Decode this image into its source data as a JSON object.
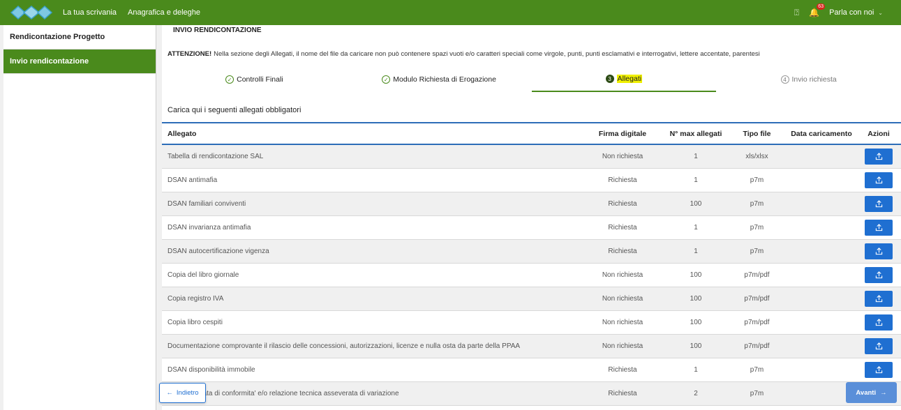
{
  "header": {
    "nav": [
      "La tua scrivania",
      "Anagrafica e deleghe"
    ],
    "notification_count": "63",
    "talk_label": "Parla con noi",
    "colors": {
      "brand": "#4a8a1c",
      "accent": "#1f6fd1"
    }
  },
  "sidebar": {
    "items": [
      {
        "label": "Rendicontazione Progetto"
      },
      {
        "label": "Invio rendicontazione"
      }
    ]
  },
  "main": {
    "title": "INVIO RENDICONTAZIONE",
    "warning_prefix": "ATTENZIONE!",
    "warning_text": "Nella sezione degli Allegati, il nome del file da caricare non può contenere spazi vuoti e/o caratteri speciali come virgole, punti, punti esclamativi e interrogativi, lettere accentate, parentesi",
    "steps": [
      {
        "label": "Controlli Finali",
        "marker": "✓"
      },
      {
        "label": "Modulo Richiesta di Erogazione",
        "marker": "✓"
      },
      {
        "label": "Allegati",
        "marker": "3"
      },
      {
        "label": "Invio richiesta",
        "marker": "4"
      }
    ],
    "caption": "Carica qui i seguenti allegati obbligatori",
    "table": {
      "headers": [
        "Allegato",
        "Firma digitale",
        "N° max allegati",
        "Tipo file",
        "Data caricamento",
        "Azioni"
      ],
      "rows": [
        [
          "Tabella di rendicontazione SAL",
          "Non richiesta",
          "1",
          "xls/xlsx",
          ""
        ],
        [
          "DSAN antimafia",
          "Richiesta",
          "1",
          "p7m",
          ""
        ],
        [
          "DSAN familiari conviventi",
          "Richiesta",
          "100",
          "p7m",
          ""
        ],
        [
          "DSAN invarianza antimafia",
          "Richiesta",
          "1",
          "p7m",
          ""
        ],
        [
          "DSAN autocertificazione vigenza",
          "Richiesta",
          "1",
          "p7m",
          ""
        ],
        [
          "Copia del libro giornale",
          "Non richiesta",
          "100",
          "p7m/pdf",
          ""
        ],
        [
          "Copia registro IVA",
          "Non richiesta",
          "100",
          "p7m/pdf",
          ""
        ],
        [
          "Copia libro cespiti",
          "Non richiesta",
          "100",
          "p7m/pdf",
          ""
        ],
        [
          "Documentazione comprovante il rilascio delle concessioni, autorizzazioni, licenze e nulla osta da parte della PPAA",
          "Non richiesta",
          "100",
          "p7m/pdf",
          ""
        ],
        [
          "DSAN disponibilità immobile",
          "Richiesta",
          "1",
          "p7m",
          ""
        ],
        [
          "ica asseverata di conformita' e/o relazione tecnica asseverata di variazione",
          "Richiesta",
          "2",
          "p7m",
          ""
        ]
      ]
    }
  },
  "footer": {
    "back_label": "Indietro",
    "next_label": "Avanti"
  }
}
